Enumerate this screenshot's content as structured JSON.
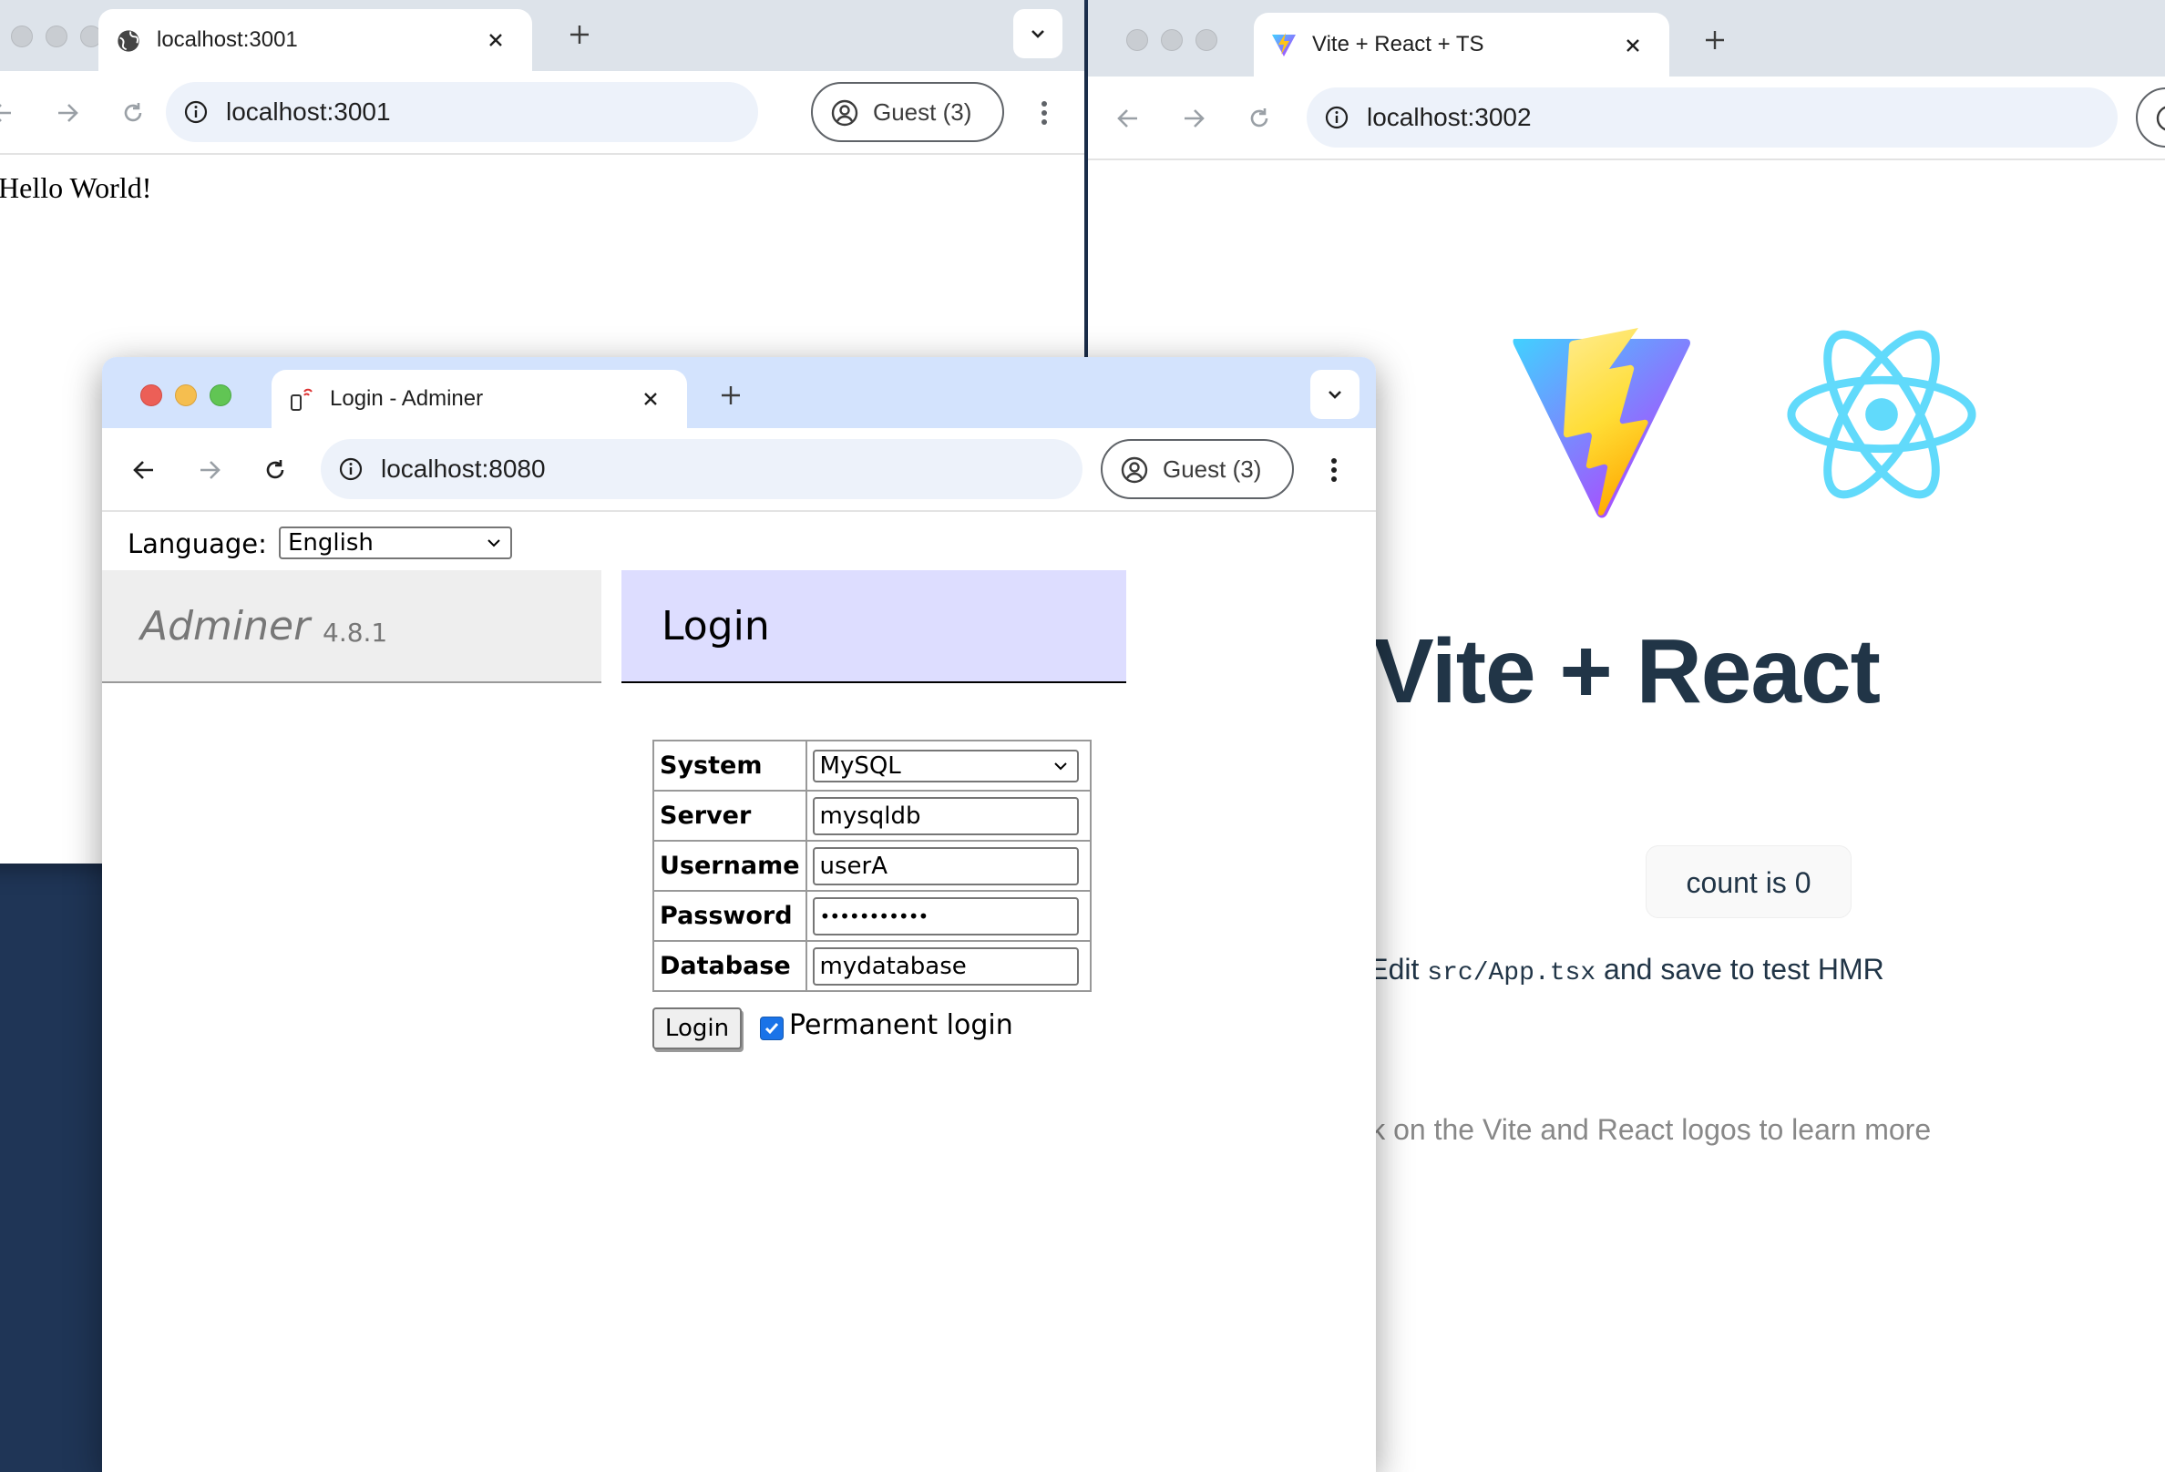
{
  "window_localhost_3001": {
    "tab_title": "localhost:3001",
    "url": "localhost:3001",
    "guest_label": "Guest (3)",
    "content_text": "Hello World!"
  },
  "window_vite": {
    "tab_title": "Vite + React + TS",
    "url": "localhost:3002",
    "heading": "Vite + React",
    "count_button_label": "count is 0",
    "hmr_prefix": "Edit",
    "hmr_code": "src/App.tsx",
    "hmr_suffix": "and save to test HMR",
    "read_docs": "Click on the Vite and React logos to learn more"
  },
  "window_adminer": {
    "tab_title": "Login - Adminer",
    "url": "localhost:8080",
    "guest_label": "Guest (3)",
    "language_label": "Language:",
    "language_value": "English",
    "brand": "Adminer",
    "version": "4.8.1",
    "page_heading": "Login",
    "form": {
      "system_label": "System",
      "system_value": "MySQL",
      "server_label": "Server",
      "server_value": "mysqldb",
      "username_label": "Username",
      "username_value": "userA",
      "password_label": "Password",
      "password_value": "•••••••••••",
      "database_label": "Database",
      "database_value": "mydatabase",
      "submit_label": "Login",
      "permanent_login_label": "Permanent login",
      "permanent_login_checked": true
    }
  },
  "icons": {
    "globe": "globe-icon",
    "vite_favicon": "vite-favicon-icon",
    "adminer_favicon": "adminer-favicon-icon",
    "close": "close-icon",
    "new_tab": "plus-icon",
    "tab_menu": "chevron-down-icon",
    "back": "back-arrow-icon",
    "forward": "forward-arrow-icon",
    "reload": "reload-icon",
    "site_info": "info-icon",
    "profile": "profile-icon",
    "more": "more-vert-icon"
  },
  "colors": {
    "tabstrip_inactive": "#dde3ea",
    "tabstrip_active": "#d3e3fd",
    "adminer_heading_bg": "#ddddff",
    "adminer_menu_bg": "#eeeeee",
    "vite_heading": "#213547",
    "checkbox_accent": "#1a73e8"
  }
}
